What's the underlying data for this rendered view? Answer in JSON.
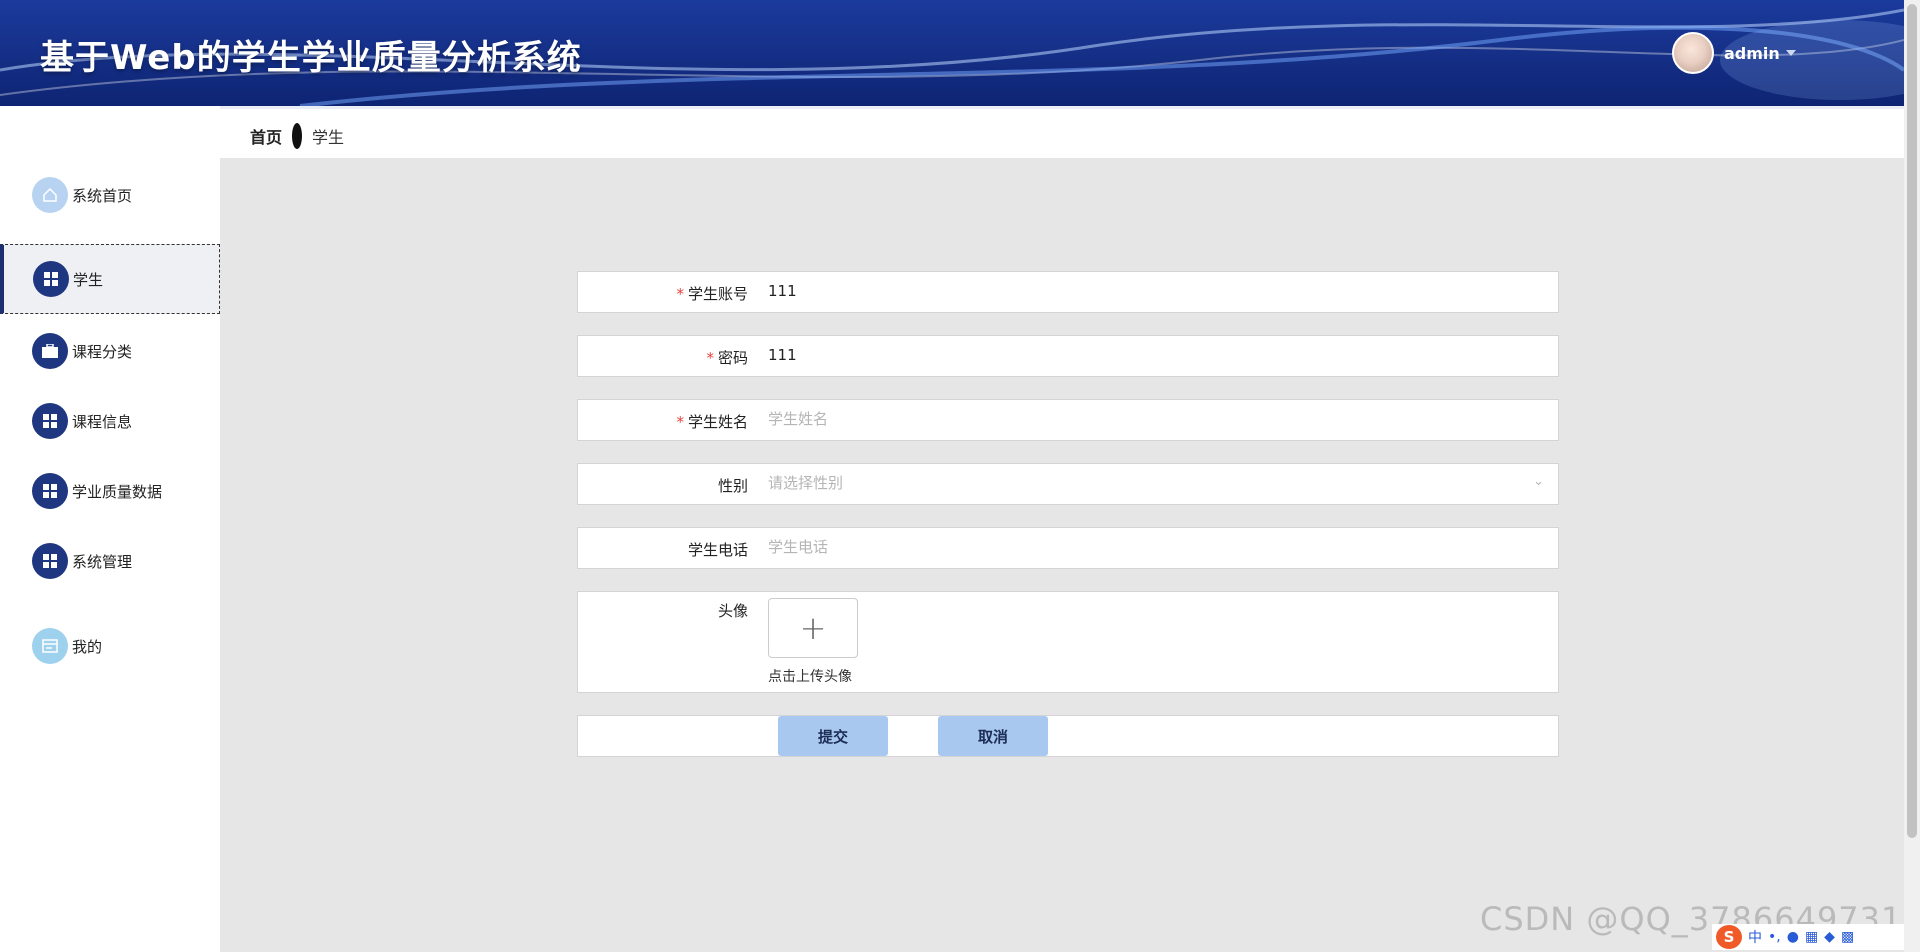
{
  "header": {
    "title": "基于Web的学生学业质量分析系统",
    "user_name": "admin"
  },
  "breadcrumb": {
    "home": "首页",
    "current": "学生"
  },
  "sidebar": {
    "items": [
      {
        "label": "系统首页",
        "icon": "home-icon"
      },
      {
        "label": "学生",
        "icon": "grid-icon"
      },
      {
        "label": "课程分类",
        "icon": "briefcase-icon"
      },
      {
        "label": "课程信息",
        "icon": "grid-icon"
      },
      {
        "label": "学业质量数据",
        "icon": "grid-icon"
      },
      {
        "label": "系统管理",
        "icon": "grid-icon"
      },
      {
        "label": "我的",
        "icon": "card-icon"
      }
    ]
  },
  "form": {
    "account": {
      "label": "学生账号",
      "value": "111"
    },
    "password": {
      "label": "密码",
      "value": "111"
    },
    "name": {
      "label": "学生姓名",
      "placeholder": "学生姓名"
    },
    "gender": {
      "label": "性别",
      "placeholder": "请选择性别"
    },
    "phone": {
      "label": "学生电话",
      "placeholder": "学生电话"
    },
    "avatar": {
      "label": "头像",
      "hint": "点击上传头像"
    },
    "required_mark": "*",
    "submit_label": "提交",
    "cancel_label": "取消"
  },
  "watermark": "CSDN @QQ_3786649731",
  "tray": {
    "ime": "中"
  },
  "colors": {
    "header": "#16318a",
    "accent_button": "#a8c8f0",
    "menu_icon": "#1f3680",
    "content_bg": "#e6e6e6"
  }
}
